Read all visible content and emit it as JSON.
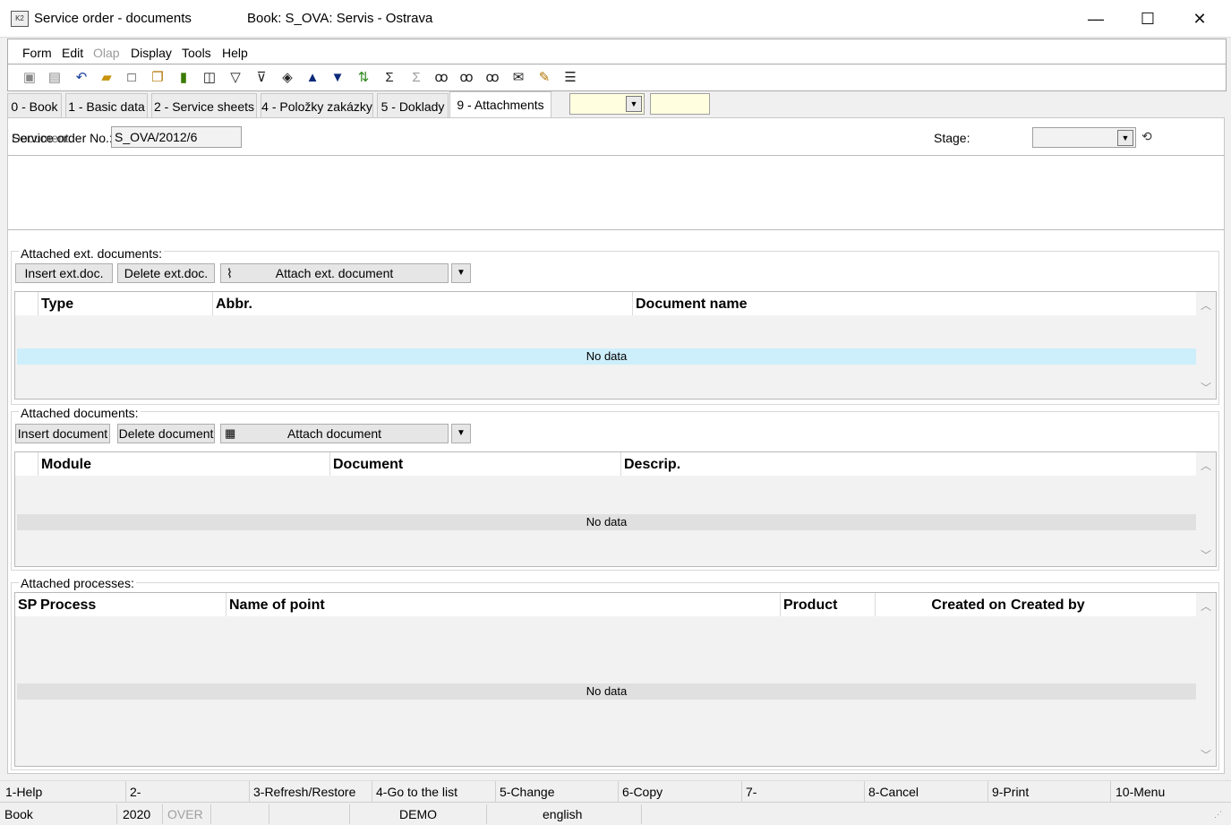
{
  "window": {
    "title": "Service order - documents",
    "book_title": "Book: S_OVA: Servis - Ostrava",
    "minimize": "—",
    "maximize": "☐",
    "close": "✕"
  },
  "menu": [
    "Form",
    "Edit",
    "Olap",
    "Display",
    "Tools",
    "Help"
  ],
  "toolbar_icons": [
    "save-icon",
    "save-all-icon",
    "undo-icon",
    "open-folder-icon",
    "new-document-icon",
    "copy-icon",
    "lock-icon",
    "book-icon",
    "filter-icon",
    "filter-list-icon",
    "stack-icon",
    "arrow-up-icon",
    "arrow-down-icon",
    "sort-icon",
    "sum-icon",
    "sum-disabled-icon",
    "binoculars-icon",
    "find-next-icon",
    "find-prev-icon",
    "mail-icon",
    "edit-note-icon",
    "menu-icon"
  ],
  "tabs": [
    {
      "label": "0 - Book"
    },
    {
      "label": "1 - Basic data"
    },
    {
      "label": "2 - Service sheets"
    },
    {
      "label": "4 - Položky zakázky"
    },
    {
      "label": "5 - Doklady"
    },
    {
      "label": "9 - Attachments",
      "active": true
    }
  ],
  "header": {
    "doc_label": "Service order No.:",
    "doc_label_overlay": "Document:",
    "doc_value": "S_OVA/2012/6",
    "stage_label": "Stage:",
    "stage_value": ""
  },
  "ext_docs": {
    "title": "Attached ext. documents:",
    "insert_btn": "Insert ext.doc.",
    "delete_btn": "Delete ext.doc.",
    "attach_btn": "Attach ext. document",
    "columns": [
      "Type",
      "Abbr.",
      "Document name"
    ],
    "no_data": "No data"
  },
  "docs": {
    "title": "Attached documents:",
    "insert_btn": "Insert document",
    "delete_btn": "Delete document",
    "attach_btn": "Attach document",
    "columns": [
      "Module",
      "Document",
      "Descrip."
    ],
    "no_data": "No data"
  },
  "processes": {
    "title": "Attached processes:",
    "columns": [
      "SP",
      "Process",
      "Name of point",
      "Product",
      "Created on",
      "Created by"
    ],
    "no_data": "No data"
  },
  "fkeys": [
    "1-Help",
    "2-",
    "3-Refresh/Restore",
    "4-Go to the list",
    "5-Change",
    "6-Copy",
    "7-",
    "8-Cancel",
    "9-Print",
    "10-Menu"
  ],
  "status": {
    "module": "Book",
    "year": "2020",
    "mode": "OVER",
    "db": "DEMO",
    "lang": "english"
  },
  "colors": {
    "selected_row": "#cdeefb",
    "yellow_field": "#ffffe0"
  }
}
